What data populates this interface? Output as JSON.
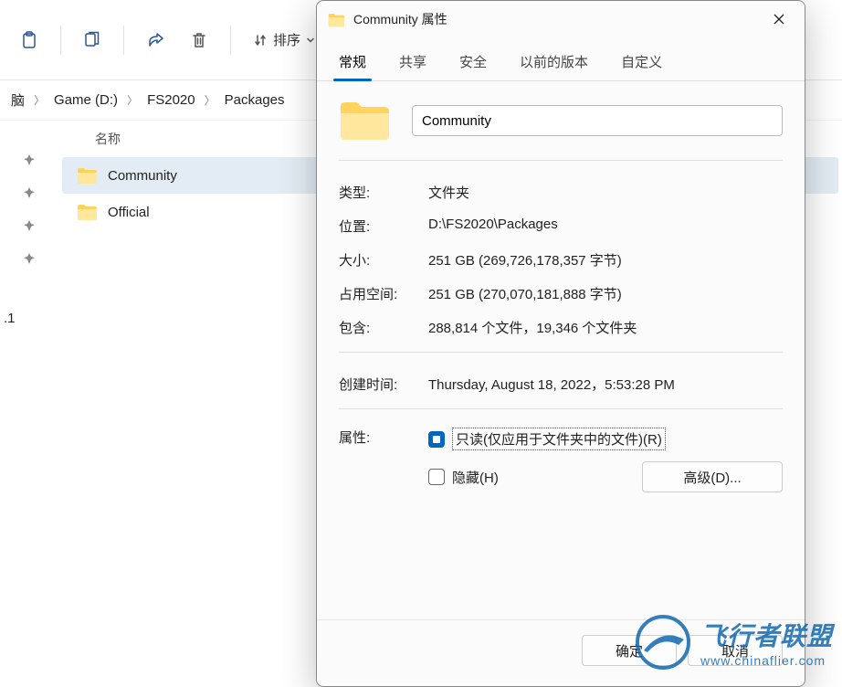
{
  "toolbar": {
    "sort_label": "排序"
  },
  "breadcrumb": {
    "items": [
      "脑",
      "Game (D:)",
      "FS2020",
      "Packages"
    ]
  },
  "filelist": {
    "header_name": "名称",
    "items": [
      {
        "name": "Community",
        "selected": true
      },
      {
        "name": "Official",
        "selected": false
      }
    ]
  },
  "bottom_fragment": ".1",
  "dialog": {
    "title": "Community 属性",
    "tabs": [
      "常规",
      "共享",
      "安全",
      "以前的版本",
      "自定义"
    ],
    "name_value": "Community",
    "props": {
      "type_label": "类型:",
      "type_value": "文件夹",
      "location_label": "位置:",
      "location_value": "D:\\FS2020\\Packages",
      "size_label": "大小:",
      "size_value": "251 GB (269,726,178,357 字节)",
      "sizeondisk_label": "占用空间:",
      "sizeondisk_value": "251 GB (270,070,181,888 字节)",
      "contains_label": "包含:",
      "contains_value": "288,814 个文件，19,346 个文件夹",
      "created_label": "创建时间:",
      "created_value": "Thursday, August 18, 2022，5:53:28 PM",
      "attr_label": "属性:",
      "readonly_label": "只读(仅应用于文件夹中的文件)(R)",
      "hidden_label": "隐藏(H)",
      "advanced_label": "高级(D)..."
    },
    "ok": "确定",
    "cancel": "取消"
  },
  "watermark": {
    "big": "飞行者联盟",
    "small": "www.chinaflier.com"
  }
}
